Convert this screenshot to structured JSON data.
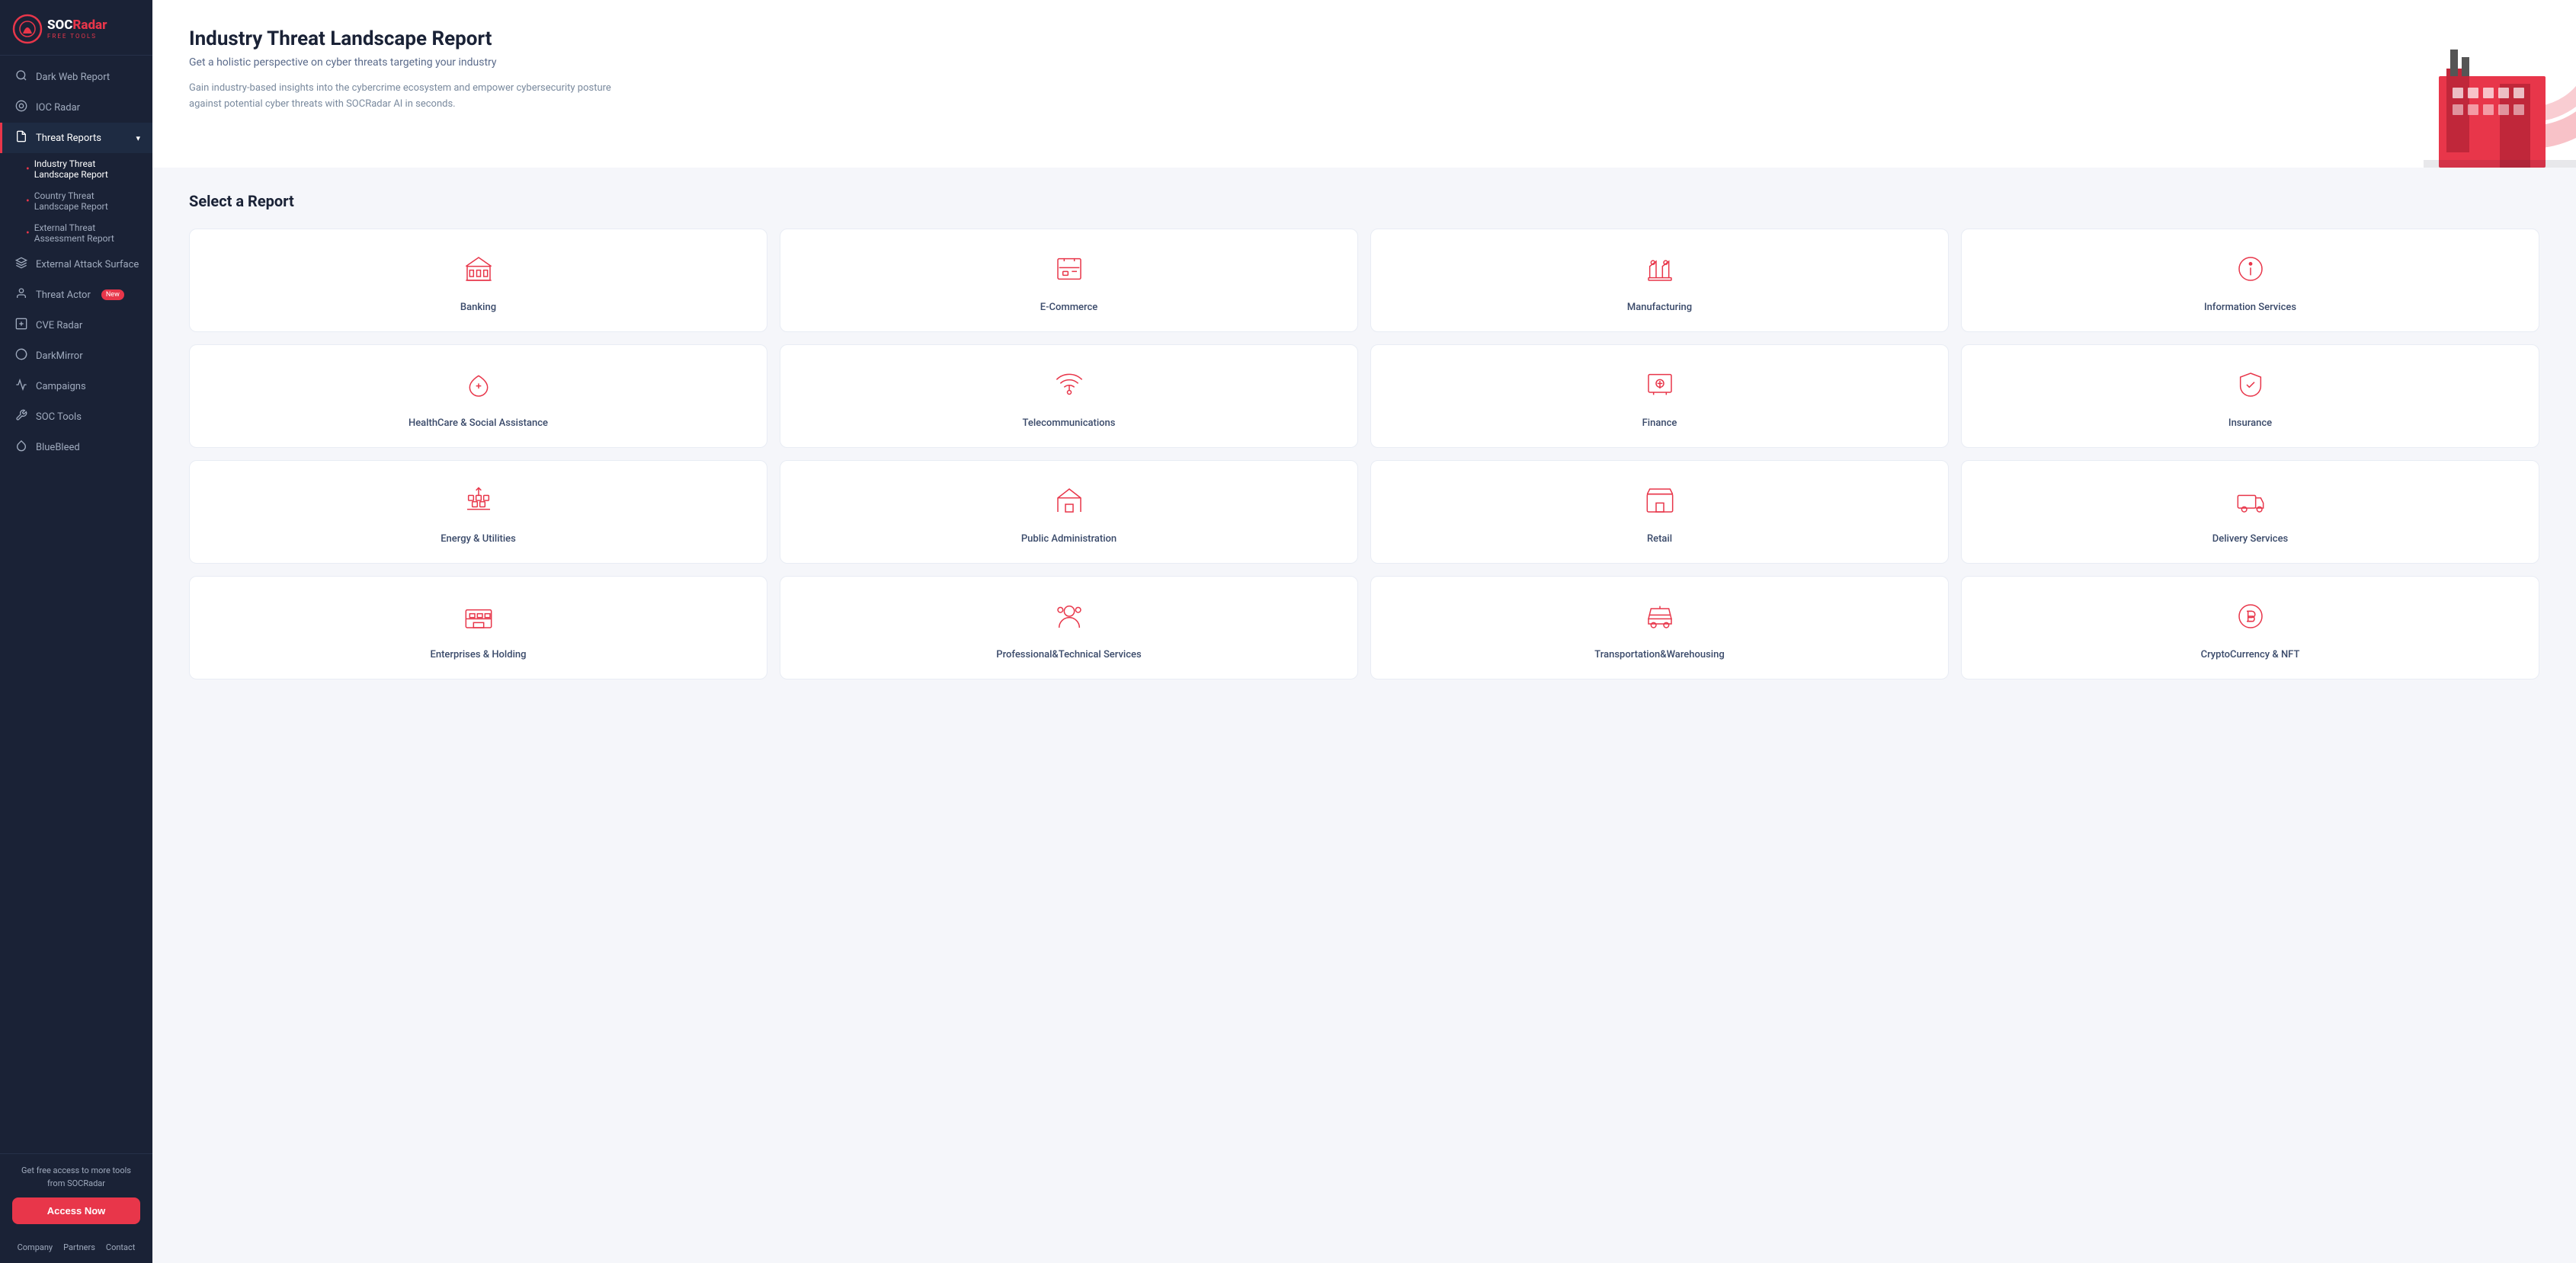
{
  "logo": {
    "brand": "SOCRadar",
    "tagline": "FREE TOOLS"
  },
  "sidebar": {
    "nav_items": [
      {
        "id": "dark-web",
        "label": "Dark Web Report",
        "icon": "🔍"
      },
      {
        "id": "ioc-radar",
        "label": "IOC Radar",
        "icon": "⊙"
      },
      {
        "id": "threat-reports",
        "label": "Threat Reports",
        "icon": "📄",
        "has_arrow": true,
        "active": true
      },
      {
        "id": "ext-attack",
        "label": "External Attack Surface",
        "icon": "⊕"
      },
      {
        "id": "threat-actor",
        "label": "Threat Actor",
        "icon": "👤",
        "badge": "New"
      },
      {
        "id": "cve-radar",
        "label": "CVE Radar",
        "icon": "⊡"
      },
      {
        "id": "darkmirror",
        "label": "DarkMirror",
        "icon": "◎"
      },
      {
        "id": "campaigns",
        "label": "Campaigns",
        "icon": "⊛"
      },
      {
        "id": "soc-tools",
        "label": "SOC Tools",
        "icon": "🔧"
      },
      {
        "id": "bluebleed",
        "label": "BlueBleed",
        "icon": "💧"
      }
    ],
    "sub_items": [
      {
        "id": "industry-threat",
        "label": "Industry Threat Landscape Report",
        "active": true
      },
      {
        "id": "country-threat",
        "label": "Country Threat Landscape Report"
      },
      {
        "id": "external-threat",
        "label": "External Threat Assessment Report"
      }
    ],
    "promo_text": "Get free access to more tools from SOCRadar",
    "access_label": "Access Now",
    "footer_links": [
      "Company",
      "Partners",
      "Contact"
    ]
  },
  "hero": {
    "title": "Industry Threat Landscape Report",
    "subtitle": "Get a holistic perspective on cyber threats targeting your industry",
    "description": "Gain industry-based insights into the cybercrime ecosystem and empower cybersecurity posture against potential cyber threats with SOCRadar AI in seconds."
  },
  "select_report": {
    "label": "Select a Report"
  },
  "reports": [
    {
      "id": "banking",
      "label": "Banking",
      "icon": "bank"
    },
    {
      "id": "ecommerce",
      "label": "E-Commerce",
      "icon": "ecommerce"
    },
    {
      "id": "manufacturing",
      "label": "Manufacturing",
      "icon": "manufacturing"
    },
    {
      "id": "information-services",
      "label": "Information Services",
      "icon": "info"
    },
    {
      "id": "healthcare",
      "label": "HealthCare & Social Assistance",
      "icon": "healthcare"
    },
    {
      "id": "telecom",
      "label": "Telecommunications",
      "icon": "telecom"
    },
    {
      "id": "finance",
      "label": "Finance",
      "icon": "finance"
    },
    {
      "id": "insurance",
      "label": "Insurance",
      "icon": "insurance"
    },
    {
      "id": "energy",
      "label": "Energy & Utilities",
      "icon": "energy"
    },
    {
      "id": "public-admin",
      "label": "Public Administration",
      "icon": "public"
    },
    {
      "id": "retail",
      "label": "Retail",
      "icon": "retail"
    },
    {
      "id": "delivery",
      "label": "Delivery Services",
      "icon": "delivery"
    },
    {
      "id": "enterprises",
      "label": "Enterprises & Holding",
      "icon": "enterprises"
    },
    {
      "id": "professional",
      "label": "Professional&Technical Services",
      "icon": "professional"
    },
    {
      "id": "transport",
      "label": "Transportation&Warehousing",
      "icon": "transport"
    },
    {
      "id": "crypto",
      "label": "CryptoCurrency & NFT",
      "icon": "crypto"
    }
  ]
}
